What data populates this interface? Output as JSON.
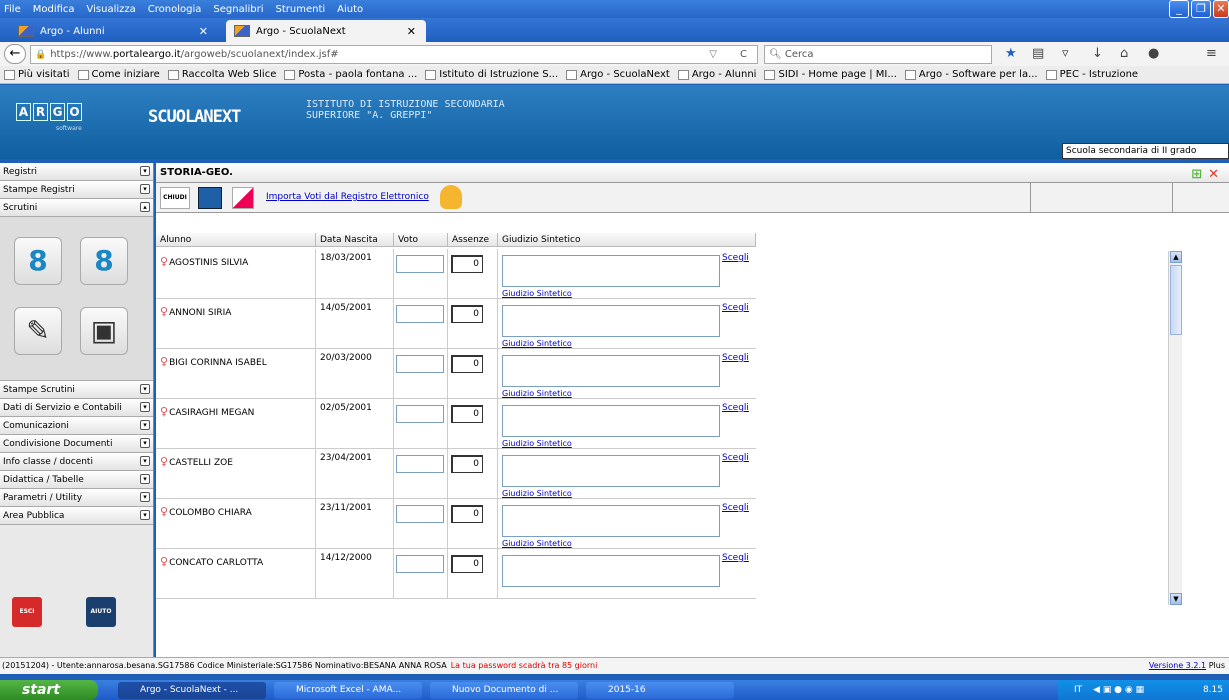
{
  "browser": {
    "menu": [
      "File",
      "Modifica",
      "Visualizza",
      "Cronologia",
      "Segnalibri",
      "Strumenti",
      "Aiuto"
    ],
    "tabs": [
      {
        "label": "Argo - Alunni",
        "active": false
      },
      {
        "label": "Argo - ScuolaNext",
        "active": true
      }
    ],
    "url_prefix": "https://www.",
    "url_domain": "portaleargo.it",
    "url_rest": "/argoweb/scuolanext/index.jsf#",
    "search_placeholder": "Cerca",
    "bookmarks": [
      "Più visitati",
      "Come iniziare",
      "Raccolta Web Slice",
      "Posta - paola fontana ...",
      "Istituto di Istruzione S...",
      "Argo - ScuolaNext",
      "Argo - Alunni",
      "SIDI - Home page | MI...",
      "Argo - Software per la...",
      "PEC - Istruzione"
    ]
  },
  "app": {
    "logo_letters": [
      "A",
      "R",
      "G",
      "O"
    ],
    "logo_sub": "software",
    "product": "SCUOLANEXT",
    "school_line1": "ISTITUTO DI ISTRUZIONE SECONDARIA",
    "school_line2": "SUPERIORE \"A. GREPPI\"",
    "grade_select": "Scuola secondaria di II grado"
  },
  "sidebar": {
    "sections_top": [
      "Registri",
      "Stampe Registri",
      "Scrutini"
    ],
    "sections_bottom": [
      "Stampe Scrutini",
      "Dati di Servizio e Contabili",
      "Comunicazioni",
      "Condivisione Documenti",
      "Info classe / docenti",
      "Didattica / Tabelle",
      "Parametri / Utility",
      "Area Pubblica"
    ],
    "esci": "ESCI",
    "aiuto": "AIUTO"
  },
  "main": {
    "subject": "STORIA-GEO.",
    "chiudi": "CHIUDI",
    "import_link": "Importa Voti dal Registro Elettronico",
    "headers": [
      "Alunno",
      "Data Nascita",
      "Voto",
      "Assenze",
      "Giudizio Sintetico"
    ],
    "scegli": "Scegli",
    "giudizio_link": "Giudizio Sintetico",
    "students": [
      {
        "name": "AGOSTINIS SILVIA",
        "dob": "18/03/2001",
        "assenze": "0"
      },
      {
        "name": "ANNONI SIRIA",
        "dob": "14/05/2001",
        "assenze": "0"
      },
      {
        "name": "BIGI CORINNA ISABEL",
        "dob": "20/03/2000",
        "assenze": "0"
      },
      {
        "name": "CASIRAGHI MEGAN",
        "dob": "02/05/2001",
        "assenze": "0"
      },
      {
        "name": "CASTELLI ZOE",
        "dob": "23/04/2001",
        "assenze": "0"
      },
      {
        "name": "COLOMBO CHIARA",
        "dob": "23/11/2001",
        "assenze": "0"
      },
      {
        "name": "CONCATO CARLOTTA",
        "dob": "14/12/2000",
        "assenze": "0"
      }
    ]
  },
  "footer": {
    "info": "(20151204) - Utente:annarosa.besana.SG17586 Codice Ministeriale:SG17586 Nominativo:BESANA ANNA ROSA",
    "warning": "La tua password scadrà tra 85 giorni",
    "version": "Versione 3.2.1",
    "version_suffix": "Plus"
  },
  "taskbar": {
    "start": "start",
    "tasks": [
      "Argo - ScuolaNext - ...",
      "Microsoft Excel - AMA...",
      "Nuovo Documento di ...",
      "2015-16"
    ],
    "lang": "IT",
    "time": "8.15"
  }
}
